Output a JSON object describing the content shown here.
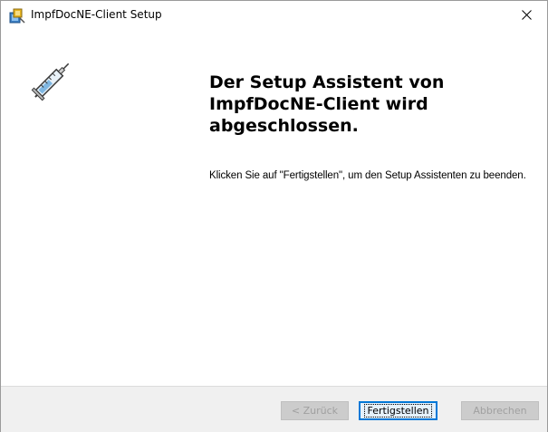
{
  "window": {
    "title": "ImpfDocNE-Client Setup",
    "icon": "installer-icon",
    "close_icon": "close-icon"
  },
  "content": {
    "image_icon": "syringe-icon",
    "heading": "Der Setup Assistent von ImpfDocNE-Client wird abgeschlossen.",
    "body": "Klicken Sie auf \"Fertigstellen\", um den Setup Assistenten zu beenden."
  },
  "buttons": {
    "back": "< Zurück",
    "finish": "Fertigstellen",
    "cancel": "Abbrechen"
  },
  "colors": {
    "accent": "#0078d7",
    "footer_bg": "#f0f0f0",
    "disabled_text": "#a0a0a0"
  }
}
